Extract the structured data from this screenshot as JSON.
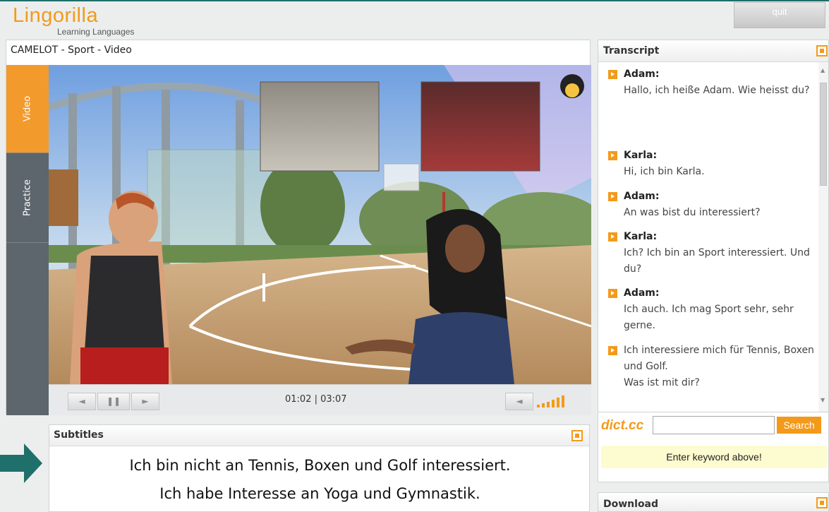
{
  "header": {
    "logo": "Lingorilla",
    "tagline": "Learning Languages",
    "quit_label": "quit"
  },
  "video": {
    "title": "CAMELOT - Sport - Video",
    "tabs": [
      {
        "label": "Video",
        "active": true
      },
      {
        "label": "Practice",
        "active": false
      }
    ],
    "time_current": "01:02",
    "time_total": "03:07",
    "time_display": "01:02 | 03:07",
    "controls": {
      "prev": "◄",
      "pause": "❚❚",
      "next": "►",
      "mute": "◄"
    }
  },
  "subtitles": {
    "title": "Subtitles",
    "lines": [
      "Ich bin nicht an Tennis, Boxen und Golf interessiert.",
      "Ich habe Interesse an Yoga und Gymnastik."
    ]
  },
  "transcript": {
    "title": "Transcript",
    "entries": [
      {
        "speaker": "Adam:",
        "text": "Hallo, ich heiße Adam. Wie heisst du?"
      },
      {
        "speaker": "Karla:",
        "text": "Hi, ich bin Karla."
      },
      {
        "speaker": "Adam:",
        "text": "An was bist du interessiert?"
      },
      {
        "speaker": "Karla:",
        "text": "Ich? Ich bin an Sport interessiert. Und du?"
      },
      {
        "speaker": "Adam:",
        "text": "Ich auch. Ich mag Sport sehr, sehr gerne."
      },
      {
        "speaker": "",
        "text": "Ich interessiere mich für Tennis, Boxen und Golf.",
        "text2": "Was ist mit dir?"
      }
    ]
  },
  "dict": {
    "logo": "dict.cc",
    "input_value": "",
    "search_label": "Search",
    "message": "Enter keyword above!"
  },
  "download": {
    "title": "Download"
  },
  "colors": {
    "accent": "#f39a1b",
    "tab_dark": "#5d666c",
    "arrow": "#1f6f6a"
  }
}
